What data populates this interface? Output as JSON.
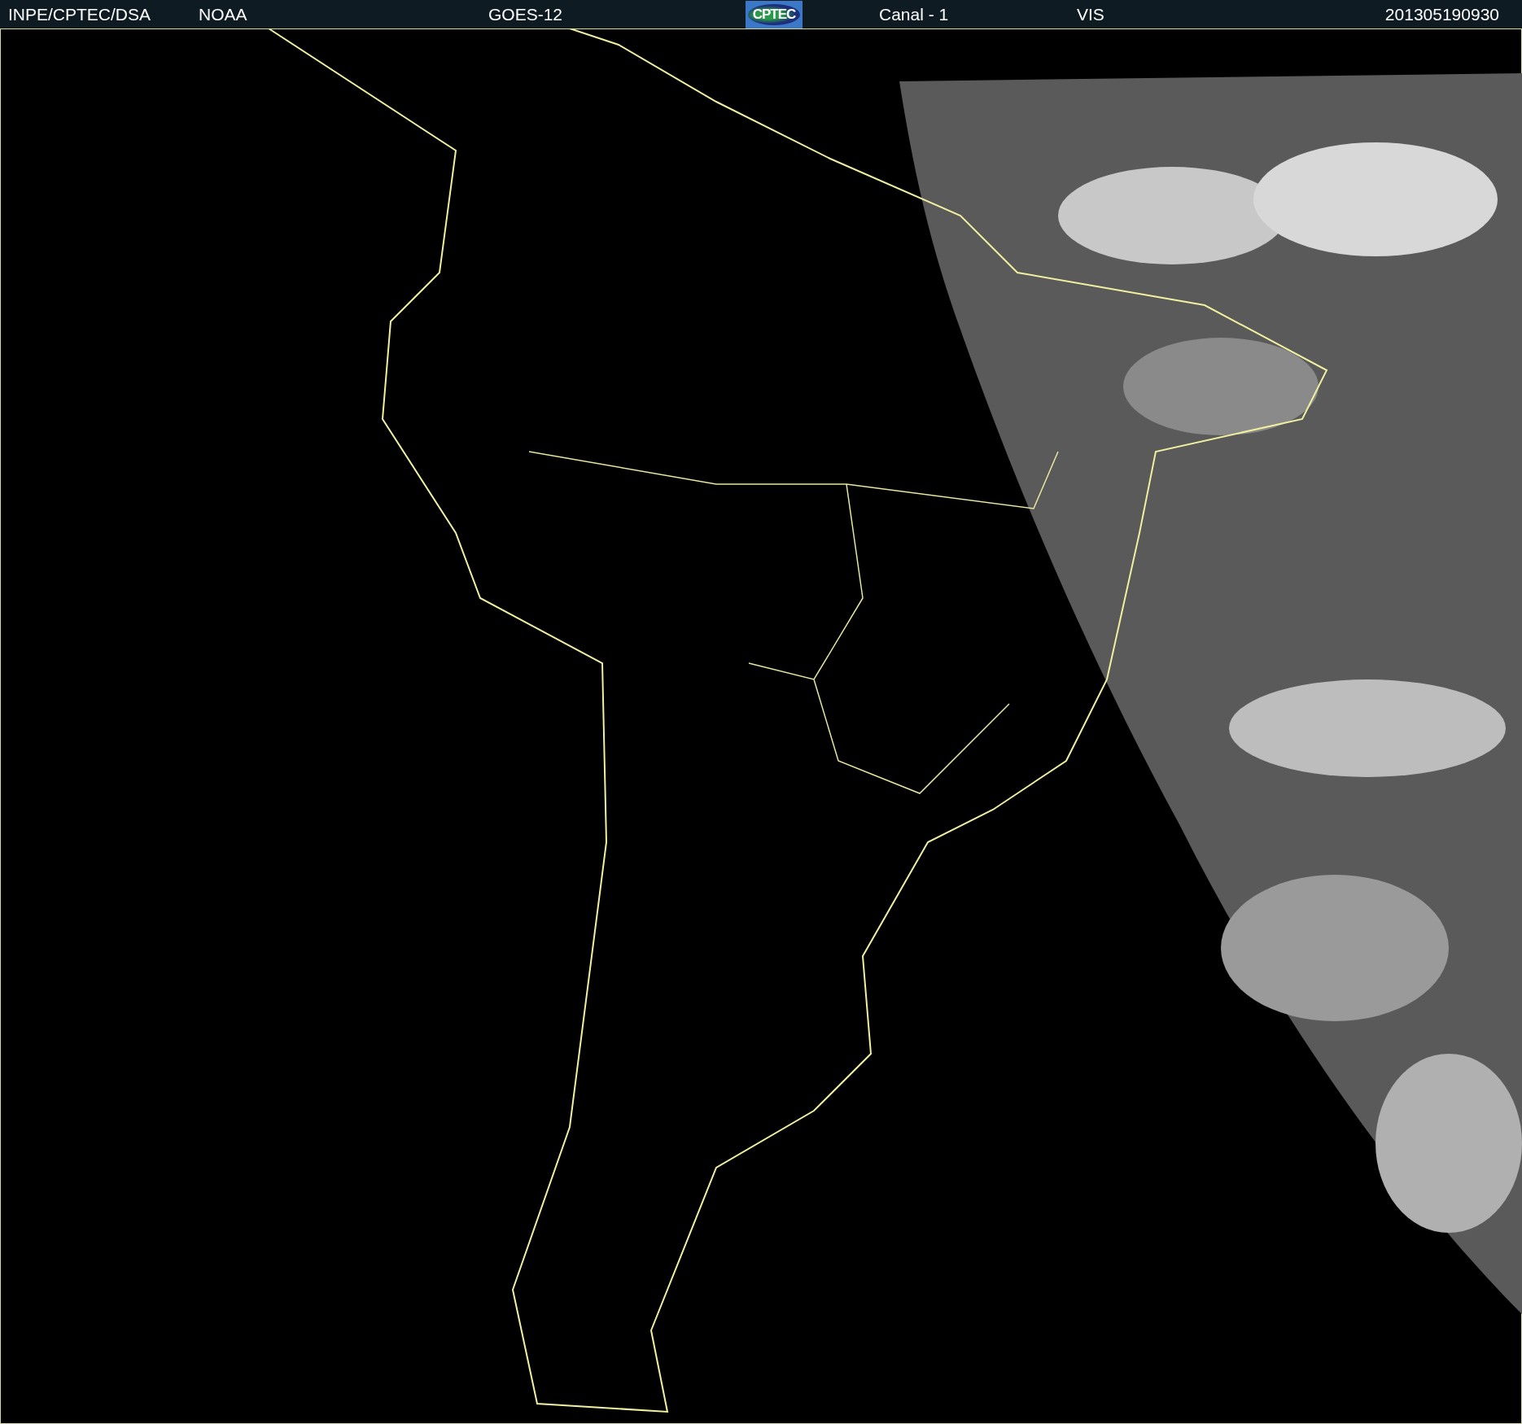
{
  "header": {
    "items": [
      {
        "kind": "text",
        "text": "INPE/CPTEC/DSA"
      },
      {
        "kind": "text",
        "text": "NOAA"
      },
      {
        "kind": "text",
        "text": "GOES-12"
      },
      {
        "kind": "logo",
        "text": "CPTEC"
      },
      {
        "kind": "text",
        "text": "Canal - 1"
      },
      {
        "kind": "text",
        "text": "VIS"
      },
      {
        "kind": "text",
        "text": "201305190930"
      }
    ]
  }
}
